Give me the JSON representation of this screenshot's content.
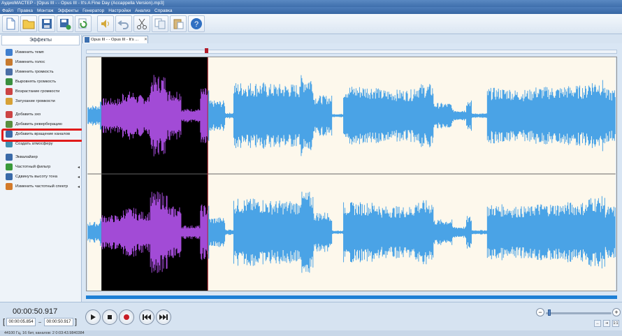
{
  "window": {
    "title": "АудиоМАСТЕР - [Opus III - - Opus III - It's A Fine Day (Accappella Version).mp3]"
  },
  "menu": [
    "Файл",
    "Правка",
    "Монтаж",
    "Эффекты",
    "Генератор",
    "Настройки",
    "Анализ",
    "Справка"
  ],
  "toolbar": [
    {
      "name": "new-file-icon",
      "color": "#5b86c0"
    },
    {
      "name": "open-folder-icon",
      "color": "#e0b44a"
    },
    {
      "name": "save-icon",
      "color": "#3a6aa8"
    },
    {
      "name": "save-as-icon",
      "color": "#3a8a4a"
    },
    {
      "name": "refresh-icon",
      "color": "#3f9a3f"
    },
    {
      "name": "speaker-icon",
      "color": "#d4a93a"
    },
    {
      "name": "undo-icon",
      "color": "#8aa2bf"
    },
    {
      "name": "cut-icon",
      "color": "#666"
    },
    {
      "name": "copy-icon",
      "color": "#8aa2bf"
    },
    {
      "name": "paste-icon",
      "color": "#c9a46a"
    },
    {
      "name": "help-icon",
      "color": "#2f6fc2"
    }
  ],
  "sidebar": {
    "title": "Эффекты",
    "items": [
      {
        "label": "Изменить темп",
        "icon": "tempo-icon",
        "arrow": ""
      },
      {
        "label": "Изменить голос",
        "icon": "voice-icon",
        "arrow": ""
      },
      {
        "label": "Изменить громкость",
        "icon": "volume-icon",
        "arrow": ""
      },
      {
        "label": "Выровнять громкость",
        "icon": "normalize-icon",
        "arrow": ""
      },
      {
        "label": "Возрастание громкости",
        "icon": "fade-in-icon",
        "arrow": ""
      },
      {
        "label": "Затухание громкости",
        "icon": "fade-out-icon",
        "arrow": ""
      },
      {
        "label": "Добавить эхо",
        "icon": "echo-icon",
        "arrow": ""
      },
      {
        "label": "Добавить реверберацию",
        "icon": "reverb-icon",
        "arrow": ""
      },
      {
        "label": "Добавить вращение каналов",
        "icon": "rotate-channels-icon",
        "arrow": ""
      },
      {
        "label": "Создать атмосферу",
        "icon": "atmosphere-icon",
        "arrow": ""
      },
      {
        "label": "Эквалайзер",
        "icon": "equalizer-icon",
        "arrow": ""
      },
      {
        "label": "Частотный фильтр",
        "icon": "filter-icon",
        "arrow": "◂"
      },
      {
        "label": "Сдвинуть высоту тона",
        "icon": "pitch-icon",
        "arrow": "◂"
      },
      {
        "label": "Изменить частотный спектр",
        "icon": "spectrum-icon",
        "arrow": "◂"
      }
    ]
  },
  "tab": {
    "label": "Opus III - - Opus III - It's ...",
    "close": "✕"
  },
  "waveform": {
    "background": "#fdf8ec",
    "wave_color": "#4aa3e6",
    "selected_wave_color": "#a24bd6",
    "selection_bg": "#000000",
    "selection_start": 0.026,
    "selection_end": 0.228
  },
  "transport": {
    "current_time": "00:00:50.917",
    "sel_start": "00:00:05.854",
    "sel_end": "00:00:50.917",
    "dash": "–",
    "bracket_open": "[",
    "bracket_close": "]",
    "zoom_minus": "−",
    "zoom_plus": "+"
  },
  "status": {
    "text": "44100 Гц, 16 бит, каналов: 2   0:03:43.9840384"
  }
}
